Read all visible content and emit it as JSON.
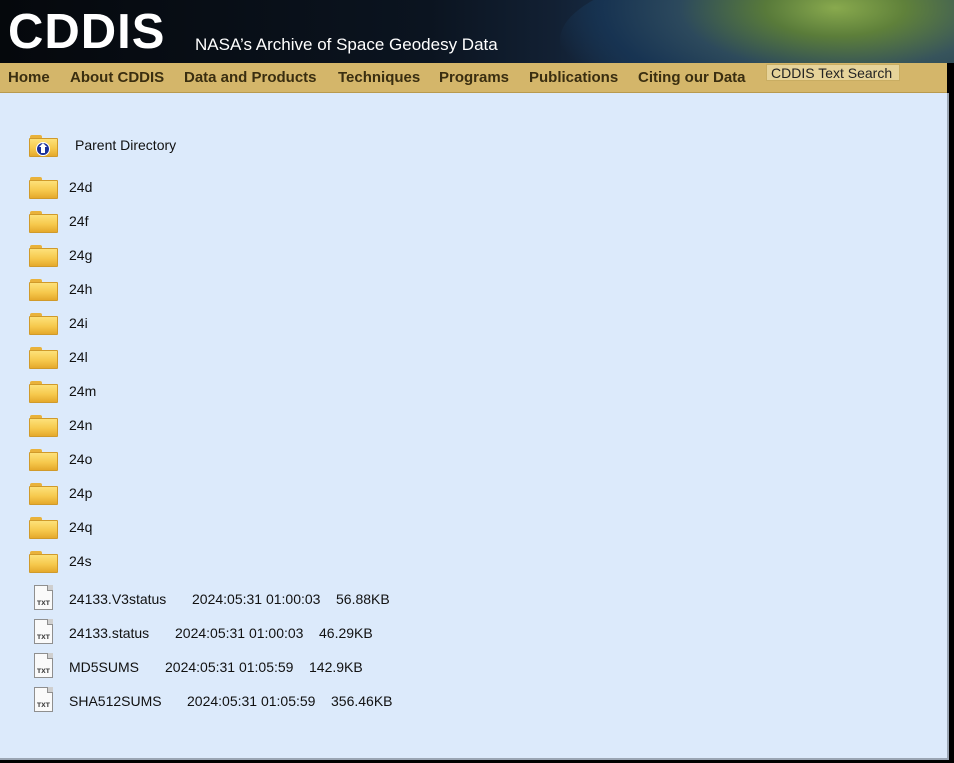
{
  "header": {
    "logo": "CDDIS",
    "tagline": "NASA’s Archive of Space Geodesy Data"
  },
  "nav": {
    "items": [
      "Home",
      "About CDDIS",
      "Data and Products",
      "Techniques",
      "Programs",
      "Publications",
      "Citing our Data"
    ],
    "search_label": "CDDIS Text Search"
  },
  "listing": {
    "parent_label": "Parent Directory",
    "folders": [
      "24d",
      "24f",
      "24g",
      "24h",
      "24i",
      "24l",
      "24m",
      "24n",
      "24o",
      "24p",
      "24q",
      "24s"
    ],
    "files": [
      {
        "name": "24133.V3status",
        "date": "2024:05:31 01:00:03",
        "size": "56.88KB"
      },
      {
        "name": "24133.status",
        "date": "2024:05:31 01:00:03",
        "size": "46.29KB"
      },
      {
        "name": "MD5SUMS",
        "date": "2024:05:31 01:05:59",
        "size": "142.9KB"
      },
      {
        "name": "SHA512SUMS",
        "date": "2024:05:31 01:05:59",
        "size": "356.46KB"
      }
    ],
    "file_icon_text": "TXT"
  }
}
